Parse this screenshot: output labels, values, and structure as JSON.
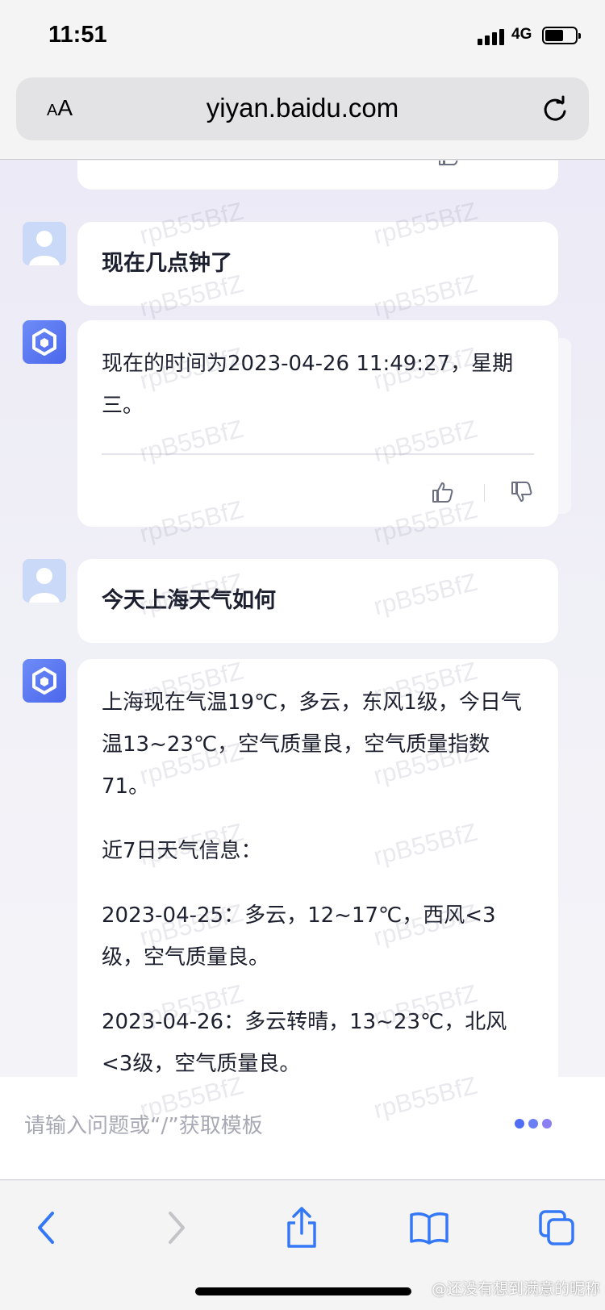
{
  "status_bar": {
    "time": "11:51",
    "network": "4G"
  },
  "browser": {
    "text_size_small": "A",
    "text_size_large": "A",
    "url": "yiyan.baidu.com"
  },
  "messages": [
    {
      "role": "user",
      "text": "现在几点钟了"
    },
    {
      "role": "assistant",
      "text": "现在的时间为2023-04-26 11:49:27，星期三。"
    },
    {
      "role": "user",
      "text": "今天上海天气如何"
    },
    {
      "role": "assistant",
      "paragraphs": [
        "上海现在气温19℃，多云，东风1级，今日气温13~23℃，空气质量良，空气质量指数71。",
        "近7日天气信息：",
        "2023-04-25：多云，12~17℃，西风<3级，空气质量良。",
        "2023-04-26：多云转晴，13~23℃，北风<3级，空气质量良。"
      ]
    }
  ],
  "watermark": "rpB55BfZ",
  "input": {
    "placeholder": "请输入问题或“/”获取模板",
    "value": ""
  },
  "credit": "@还没有想到满意的昵称",
  "icons": {
    "user_avatar": "user-avatar-icon",
    "bot_avatar": "ernie-bot-logo",
    "like": "thumbs-up-icon",
    "dislike": "thumbs-down-icon",
    "more": "more-dots-icon",
    "reload": "reload-icon",
    "back": "chevron-left-icon",
    "forward": "chevron-right-icon",
    "share": "share-icon",
    "bookmarks": "open-book-icon",
    "tabs": "tabs-icon"
  },
  "colors": {
    "accent": "#4f6df5",
    "toolbar_blue": "#3478f6",
    "disabled": "#c4c4c8"
  }
}
